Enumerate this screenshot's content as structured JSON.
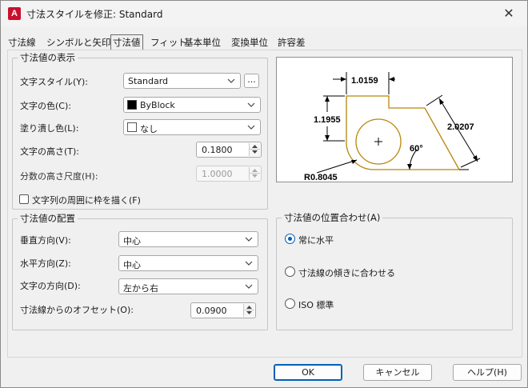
{
  "window": {
    "title": "寸法スタイルを修正: Standard",
    "close_glyph": "✕",
    "app_icon_letter": "A"
  },
  "tabs": [
    {
      "label": "寸法線"
    },
    {
      "label": "シンボルと矢印"
    },
    {
      "label": "寸法値",
      "active": true
    },
    {
      "label": "フィット"
    },
    {
      "label": "基本単位"
    },
    {
      "label": "変換単位"
    },
    {
      "label": "許容差"
    }
  ],
  "text_appearance": {
    "legend": "寸法値の表示",
    "text_style_label": "文字スタイル(Y):",
    "text_style_value": "Standard",
    "browse_label": "...",
    "text_color_label": "文字の色(C):",
    "text_color_value": "ByBlock",
    "fill_color_label": "塗り潰し色(L):",
    "fill_color_value": "なし",
    "text_height_label": "文字の高さ(T):",
    "text_height_value": "0.1800",
    "fraction_scale_label": "分数の高さ尺度(H):",
    "fraction_scale_value": "1.0000",
    "frame_label": "文字列の周囲に枠を描く(F)",
    "frame_checked": false
  },
  "text_placement": {
    "legend": "寸法値の配置",
    "vertical_label": "垂直方向(V):",
    "vertical_value": "中心",
    "horizontal_label": "水平方向(Z):",
    "horizontal_value": "中心",
    "view_direction_label": "文字の方向(D):",
    "view_direction_value": "左から右",
    "offset_label": "寸法線からのオフセット(O):",
    "offset_value": "0.0900"
  },
  "text_alignment": {
    "legend": "寸法値の位置合わせ(A)",
    "options": [
      {
        "label": "常に水平",
        "checked": true
      },
      {
        "label": "寸法線の傾きに合わせる",
        "checked": false
      },
      {
        "label": "ISO 標準",
        "checked": false
      }
    ]
  },
  "preview": {
    "dim_top": "1.0159",
    "dim_left": "1.1955",
    "dim_right": "2.0207",
    "angle": "60°",
    "radius": "R0.8045"
  },
  "buttons": {
    "ok": "OK",
    "cancel": "キャンセル",
    "help": "ヘルプ(H)"
  },
  "colors": {
    "accent": "#005fb8",
    "app_icon": "#c8102e",
    "preview_shape": "#b8860b",
    "bylock_swatch": "#000000"
  },
  "icons": {
    "dropdown": "chevron-down-icon",
    "close": "close-icon",
    "spinner_up": "arrow-up-icon",
    "spinner_down": "arrow-down-icon",
    "center_mark": "plus-icon"
  }
}
